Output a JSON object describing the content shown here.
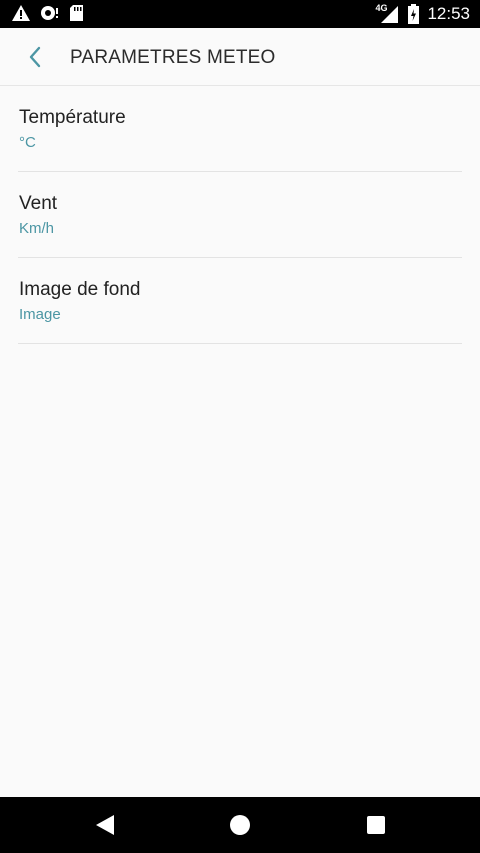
{
  "status_bar": {
    "network": "4G",
    "time": "12:53",
    "icons": [
      "warning-icon",
      "sync-icon",
      "sd-card-icon",
      "signal-icon",
      "battery-charging-icon"
    ]
  },
  "app_bar": {
    "title": "PARAMETRES METEO",
    "back_icon": "chevron-left-icon"
  },
  "settings": [
    {
      "title": "Température",
      "value": "°C"
    },
    {
      "title": "Vent",
      "value": "Km/h"
    },
    {
      "title": "Image de fond",
      "value": "Image"
    }
  ],
  "nav_bar": {
    "icons": [
      "back-triangle-icon",
      "home-circle-icon",
      "recents-square-icon"
    ]
  },
  "colors": {
    "accent": "#4c96a4",
    "background": "#fafafa",
    "text": "#222222"
  }
}
